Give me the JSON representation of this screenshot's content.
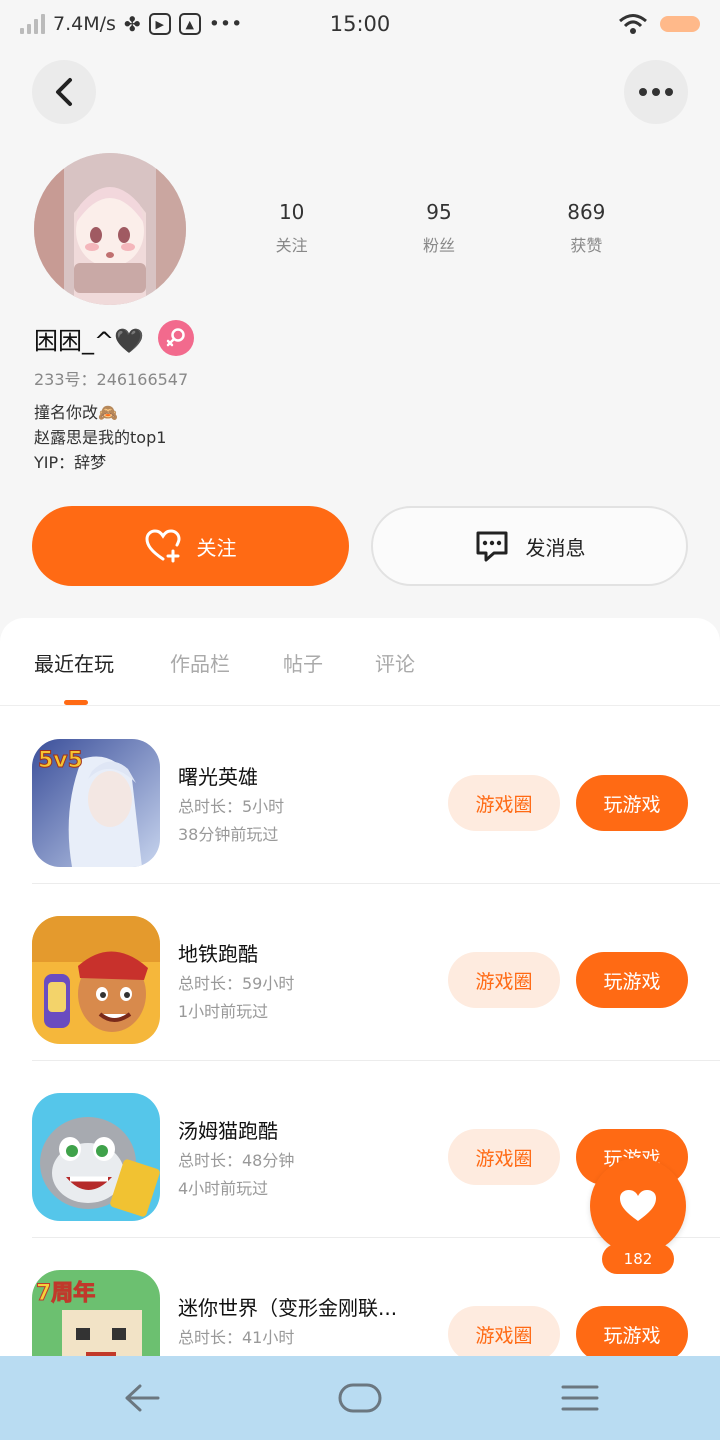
{
  "status_bar": {
    "network_speed": "7.4M/s",
    "more": "•••",
    "time": "15:00"
  },
  "profile": {
    "username": "困困_^🖤",
    "uid": "233号：246166547",
    "bio": [
      "撞名你改🙈",
      "赵露思是我的top1",
      "YIP：辞梦"
    ],
    "stats": [
      {
        "value": "10",
        "label": "关注"
      },
      {
        "value": "95",
        "label": "粉丝"
      },
      {
        "value": "869",
        "label": "获赞"
      }
    ]
  },
  "actions": {
    "follow": "关注",
    "message": "发消息"
  },
  "tabs": [
    "最近在玩",
    "作品栏",
    "帖子",
    "评论"
  ],
  "games": [
    {
      "name": "曙光英雄",
      "total_time": "总时长：5小时",
      "last_played": "38分钟前玩过",
      "circle_label": "游戏圈",
      "play_label": "玩游戏",
      "icon_badge": "5v5"
    },
    {
      "name": "地铁跑酷",
      "total_time": "总时长：59小时",
      "last_played": "1小时前玩过",
      "circle_label": "游戏圈",
      "play_label": "玩游戏"
    },
    {
      "name": "汤姆猫跑酷",
      "total_time": "总时长：48分钟",
      "last_played": "4小时前玩过",
      "circle_label": "游戏圈",
      "play_label": "玩游戏"
    },
    {
      "name": "迷你世界（变形金刚联...",
      "total_time": "总时长：41小时",
      "last_played": "",
      "circle_label": "游戏圈",
      "play_label": "玩游戏",
      "icon_badge": "7周年"
    }
  ],
  "floating_like": {
    "count": "182"
  },
  "colors": {
    "accent": "#ff6a14",
    "accent_light": "#feebdf",
    "gender": "#f26a8d",
    "nav_bar": "#b9dcf2"
  }
}
